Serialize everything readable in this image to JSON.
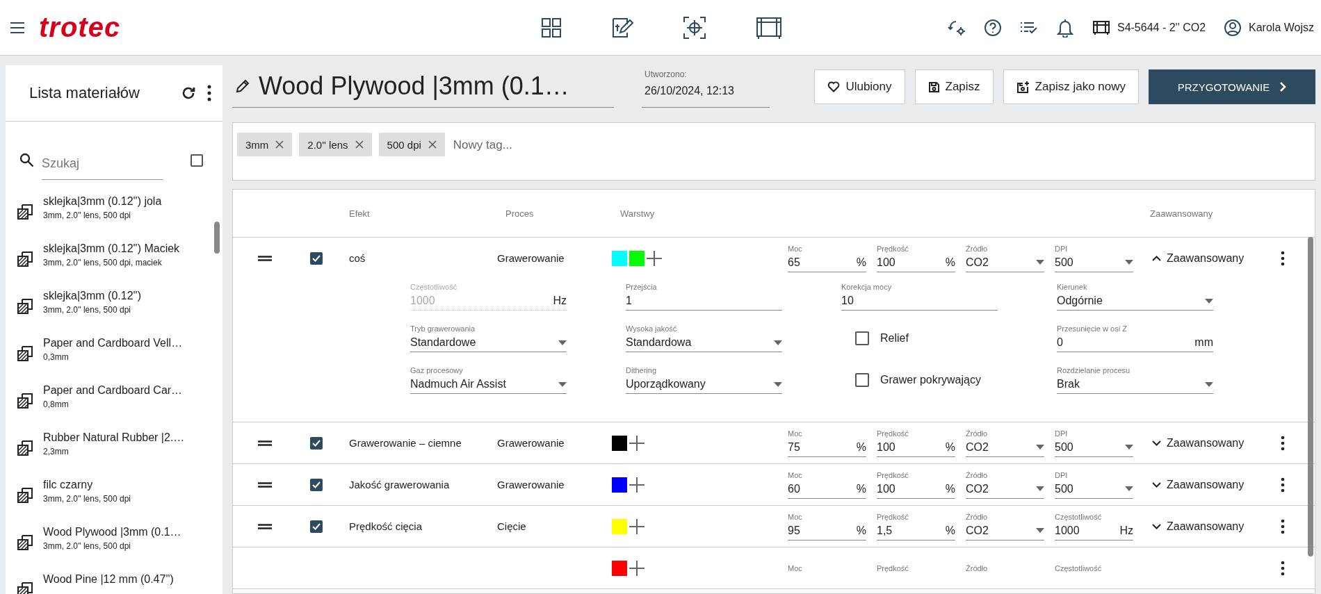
{
  "header": {
    "logo": "trotec",
    "machine": "S4-5644 - 2'' CO2",
    "user": "Karola Wojsz"
  },
  "sidebar": {
    "title": "Lista materiałów",
    "search": {
      "placeholder": "Szukaj"
    },
    "select_all": {
      "checked": false
    },
    "items": [
      {
        "name": "sklejka|3mm (0.12'') jola",
        "details": "3mm, 2.0'' lens, 500 dpi"
      },
      {
        "name": "sklejka|3mm (0.12'') Maciek",
        "details": "3mm, 2.0'' lens, 500 dpi, maciek"
      },
      {
        "name": "sklejka|3mm (0.12'')",
        "details": "3mm, 2.0'' lens, 500 dpi"
      },
      {
        "name": "Paper and Cardboard Vell…",
        "details": "0,3mm"
      },
      {
        "name": "Paper and Cardboard Car…",
        "details": "0,8mm"
      },
      {
        "name": "Rubber Natural Rubber |2.…",
        "details": "2,3mm"
      },
      {
        "name": "filc czarny",
        "details": "3mm, 2.0'' lens, 500 dpi"
      },
      {
        "name": "Wood Plywood |3mm (0.1…",
        "details": "3mm, 2.0'' lens, 500 dpi"
      },
      {
        "name": "Wood Pine |12 mm (0.47'')"
      }
    ]
  },
  "editor": {
    "title": "Wood Plywood |3mm (0.1…",
    "created_label": "Utworzono:",
    "created_value": "26/10/2024, 12:13",
    "buttons": [
      {
        "label": "Ulubiony",
        "kind": "favorite"
      },
      {
        "label": "Zapisz",
        "kind": "save"
      },
      {
        "label": "Zapisz jako nowy",
        "kind": "save_new"
      },
      {
        "label": "PRZYGOTOWANIE",
        "kind": "primary"
      }
    ],
    "tags": [
      {
        "label": "3mm"
      },
      {
        "label": "2.0'' lens"
      },
      {
        "label": "500 dpi"
      }
    ],
    "tag_placeholder": "Nowy tag..."
  },
  "table": {
    "columns": [
      "Efekt",
      "Proces",
      "Warstwy"
    ],
    "advanced_heading": "Zaawansowany",
    "rows": [
      {
        "checked": true,
        "effect": "coś",
        "process": "Grawerowanie",
        "layers": [
          {
            "color": "#00ffff"
          },
          {
            "color": "#00ff00"
          }
        ],
        "fields": [
          {
            "kind": "input",
            "label": "Moc",
            "value": "65",
            "unit": "%"
          },
          {
            "kind": "input",
            "label": "Prędkość",
            "value": "100",
            "unit": "%"
          },
          {
            "kind": "select",
            "label": "Źródło",
            "value": "CO2"
          },
          {
            "kind": "select",
            "label": "DPI",
            "value": "500"
          }
        ],
        "advanced_label": "Zaawansowany",
        "expanded": true,
        "advanced": [
          {
            "kind": "input",
            "label": "Częstotliwość",
            "value": "1000",
            "unit": "Hz",
            "disabled": true
          },
          {
            "kind": "input",
            "label": "Przejścia",
            "value": "1"
          },
          {
            "kind": "input",
            "label": "Korekcja mocy",
            "value": "10"
          },
          {
            "kind": "select",
            "label": "Kierunek",
            "value": "Odgórnie"
          },
          {
            "kind": "select",
            "label": "Tryb grawerowania",
            "value": "Standardowe"
          },
          {
            "kind": "select",
            "label": "Wysoka jakość",
            "value": "Standardowa"
          },
          {
            "kind": "checkbox",
            "label": "Relief",
            "checked": false
          },
          {
            "kind": "input",
            "label": "Przesunięcie w osi Z",
            "value": "0",
            "unit": "mm"
          },
          {
            "kind": "select",
            "label": "Gaz procesowy",
            "value": "Nadmuch Air Assist"
          },
          {
            "kind": "select",
            "label": "Dithering",
            "value": "Uporządkowany"
          },
          {
            "kind": "checkbox",
            "label": "Grawer pokrywający",
            "checked": false
          },
          {
            "kind": "select",
            "label": "Rozdzielanie procesu",
            "value": "Brak"
          }
        ]
      },
      {
        "checked": true,
        "effect": "Grawerowanie – ciemne",
        "process": "Grawerowanie",
        "layers": [
          {
            "color": "#000000"
          }
        ],
        "fields": [
          {
            "kind": "input",
            "label": "Moc",
            "value": "75",
            "unit": "%"
          },
          {
            "kind": "input",
            "label": "Prędkość",
            "value": "100",
            "unit": "%"
          },
          {
            "kind": "select",
            "label": "Źródło",
            "value": "CO2"
          },
          {
            "kind": "select",
            "label": "DPI",
            "value": "500"
          }
        ],
        "advanced_label": "Zaawansowany",
        "expanded": false
      },
      {
        "checked": true,
        "effect": "Jakość grawerowania",
        "process": "Grawerowanie",
        "layers": [
          {
            "color": "#0000ff"
          }
        ],
        "fields": [
          {
            "kind": "input",
            "label": "Moc",
            "value": "60",
            "unit": "%"
          },
          {
            "kind": "input",
            "label": "Prędkość",
            "value": "100",
            "unit": "%"
          },
          {
            "kind": "select",
            "label": "Źródło",
            "value": "CO2"
          },
          {
            "kind": "select",
            "label": "DPI",
            "value": "500"
          }
        ],
        "advanced_label": "Zaawansowany",
        "expanded": false
      },
      {
        "checked": true,
        "effect": "Prędkość cięcia",
        "process": "Cięcie",
        "layers": [
          {
            "color": "#ffff00"
          }
        ],
        "fields": [
          {
            "kind": "input",
            "label": "Moc",
            "value": "95",
            "unit": "%"
          },
          {
            "kind": "input",
            "label": "Prędkość",
            "value": "1,5",
            "unit": "%"
          },
          {
            "kind": "select",
            "label": "Źródło",
            "value": "CO2"
          },
          {
            "kind": "input",
            "label": "Częstotliwość",
            "value": "1000",
            "unit": "Hz"
          }
        ],
        "advanced_label": "Zaawansowany",
        "expanded": false
      },
      {
        "layers": [
          {
            "color": "#ff0000"
          }
        ],
        "fields": [
          {
            "kind": "input",
            "label": "Moc"
          },
          {
            "kind": "input",
            "label": "Prędkość"
          },
          {
            "kind": "select",
            "label": "Źródło"
          },
          {
            "kind": "input",
            "label": "Częstotliwość"
          }
        ]
      }
    ]
  }
}
